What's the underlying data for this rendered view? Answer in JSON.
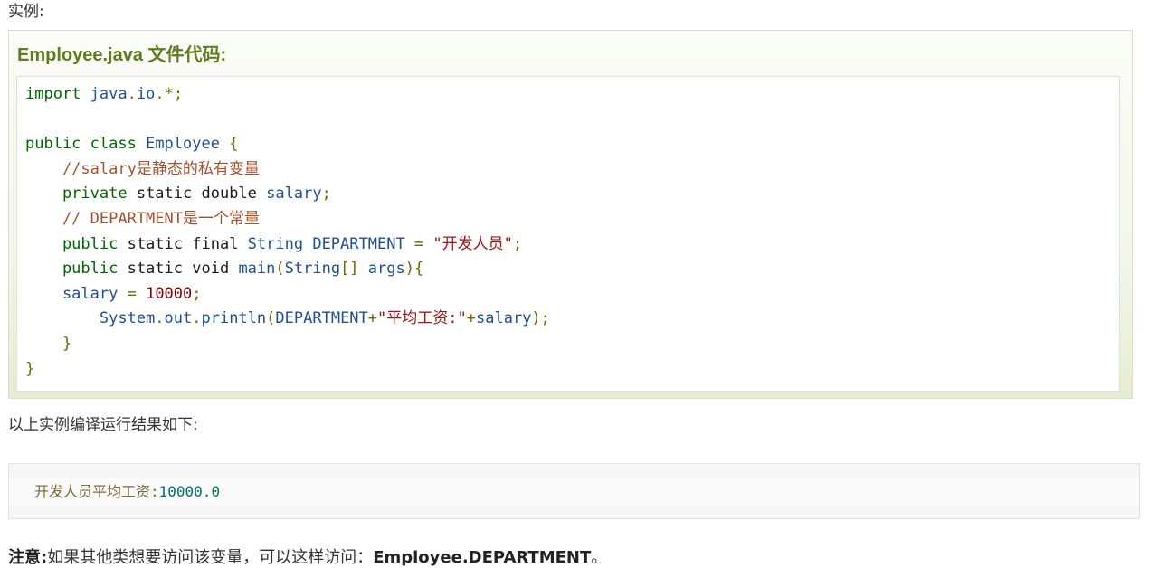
{
  "intro_label": "实例:",
  "example": {
    "title": "Employee.java 文件代码:",
    "code_lines": [
      [
        {
          "t": "import",
          "c": "kw"
        },
        {
          "t": " java",
          "c": "typ"
        },
        {
          "t": ".",
          "c": "pun"
        },
        {
          "t": "io",
          "c": "typ"
        },
        {
          "t": ".*;",
          "c": "pun"
        }
      ],
      [],
      [
        {
          "t": "public",
          "c": "kw"
        },
        {
          "t": " class",
          "c": "kw"
        },
        {
          "t": " Employee",
          "c": "typ"
        },
        {
          "t": " {",
          "c": "pun"
        }
      ],
      [
        {
          "t": "    //salary是静态的私有变量",
          "c": "com"
        }
      ],
      [
        {
          "t": "    private",
          "c": "kw"
        },
        {
          "t": " static",
          "c": "kw2"
        },
        {
          "t": " double",
          "c": "kw2"
        },
        {
          "t": " salary",
          "c": "idn"
        },
        {
          "t": ";",
          "c": "pun"
        }
      ],
      [
        {
          "t": "    // DEPARTMENT是一个常量",
          "c": "com"
        }
      ],
      [
        {
          "t": "    public",
          "c": "kw"
        },
        {
          "t": " static",
          "c": "kw2"
        },
        {
          "t": " final",
          "c": "kw2"
        },
        {
          "t": " String",
          "c": "typ"
        },
        {
          "t": " DEPARTMENT",
          "c": "idn"
        },
        {
          "t": " =",
          "c": "pun"
        },
        {
          "t": " \"开发人员\"",
          "c": "str"
        },
        {
          "t": ";",
          "c": "pun"
        }
      ],
      [
        {
          "t": "    public",
          "c": "kw"
        },
        {
          "t": " static",
          "c": "kw2"
        },
        {
          "t": " void",
          "c": "kw2"
        },
        {
          "t": " main",
          "c": "typ"
        },
        {
          "t": "(",
          "c": "pun"
        },
        {
          "t": "String",
          "c": "typ"
        },
        {
          "t": "[]",
          "c": "pun"
        },
        {
          "t": " args",
          "c": "idn"
        },
        {
          "t": "){",
          "c": "pun"
        }
      ],
      [
        {
          "t": "    salary",
          "c": "idn"
        },
        {
          "t": " =",
          "c": "pun"
        },
        {
          "t": " 10000",
          "c": "num"
        },
        {
          "t": ";",
          "c": "pun"
        }
      ],
      [
        {
          "t": "        System",
          "c": "typ"
        },
        {
          "t": ".",
          "c": "pun"
        },
        {
          "t": "out",
          "c": "typ"
        },
        {
          "t": ".",
          "c": "pun"
        },
        {
          "t": "println",
          "c": "typ"
        },
        {
          "t": "(",
          "c": "pun"
        },
        {
          "t": "DEPARTMENT",
          "c": "idn"
        },
        {
          "t": "+",
          "c": "pun"
        },
        {
          "t": "\"平均工资:\"",
          "c": "str"
        },
        {
          "t": "+",
          "c": "pun"
        },
        {
          "t": "salary",
          "c": "idn"
        },
        {
          "t": ");",
          "c": "pun"
        }
      ],
      [
        {
          "t": "    }",
          "c": "pun"
        }
      ],
      [
        {
          "t": "}",
          "c": "pun"
        }
      ]
    ]
  },
  "result_label": "以上实例编译运行结果如下:",
  "output": {
    "text_prefix": "开发人员平均工资:",
    "text_value": "10000.0"
  },
  "note": {
    "label": "注意:",
    "text": "如果其他类想要访问该变量，可以这样访问：",
    "code": "Employee.DEPARTMENT",
    "suffix": "。"
  },
  "colors": {
    "title_green": "#5e7d1d",
    "keyword": "#006600",
    "type": "#1f4f91",
    "comment": "#a0522d",
    "string": "#a31515",
    "number": "#800000"
  }
}
